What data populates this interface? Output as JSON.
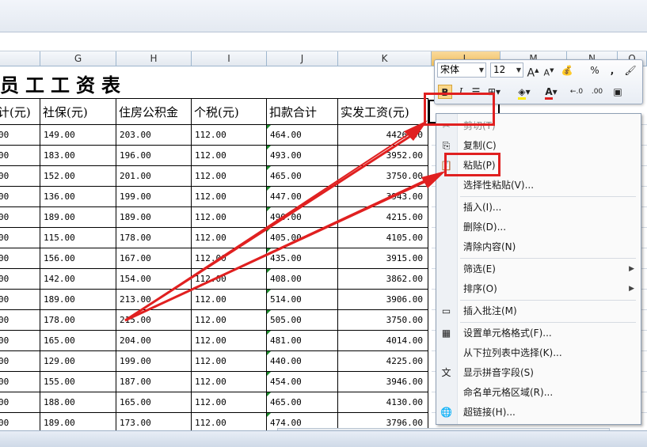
{
  "columns": [
    "G",
    "H",
    "I",
    "J",
    "K",
    "L",
    "M",
    "N",
    "O"
  ],
  "title": "员工工资表",
  "headers": [
    "计(元)",
    "社保(元)",
    "住房公积金",
    "个税(元)",
    "扣款合计",
    "实发工资(元)"
  ],
  "rows": [
    [
      "00",
      "149.00",
      "203.00",
      "112.00",
      "464.00",
      "4426.00"
    ],
    [
      "00",
      "183.00",
      "196.00",
      "112.00",
      "493.00",
      "3952.00"
    ],
    [
      "00",
      "152.00",
      "201.00",
      "112.00",
      "465.00",
      "3750.00"
    ],
    [
      "00",
      "136.00",
      "199.00",
      "112.00",
      "447.00",
      "3943.00"
    ],
    [
      "00",
      "189.00",
      "189.00",
      "112.00",
      "490.00",
      "4215.00"
    ],
    [
      "00",
      "115.00",
      "178.00",
      "112.00",
      "405.00",
      "4105.00"
    ],
    [
      "00",
      "156.00",
      "167.00",
      "112.00",
      "435.00",
      "3915.00"
    ],
    [
      "00",
      "142.00",
      "154.00",
      "112.00",
      "408.00",
      "3862.00"
    ],
    [
      "00",
      "189.00",
      "213.00",
      "112.00",
      "514.00",
      "3906.00"
    ],
    [
      "00",
      "178.00",
      "215.00",
      "112.00",
      "505.00",
      "3750.00"
    ],
    [
      "00",
      "165.00",
      "204.00",
      "112.00",
      "481.00",
      "4014.00"
    ],
    [
      "00",
      "129.00",
      "199.00",
      "112.00",
      "440.00",
      "4225.00"
    ],
    [
      "00",
      "155.00",
      "187.00",
      "112.00",
      "454.00",
      "3946.00"
    ],
    [
      "00",
      "188.00",
      "165.00",
      "112.00",
      "465.00",
      "4130.00"
    ],
    [
      "00",
      "189.00",
      "173.00",
      "112.00",
      "474.00",
      "3796.00"
    ]
  ],
  "mini_toolbar": {
    "font": "宋体",
    "size": "12",
    "grow": "A",
    "shrink": "A",
    "currency": "%",
    "comma": ",",
    "bold": "B",
    "italic": "I"
  },
  "context_menu": [
    {
      "label": "剪切(T)",
      "icon": "scissors-icon",
      "glyph": "✂",
      "disabled": true
    },
    {
      "label": "复制(C)",
      "icon": "copy-icon",
      "glyph": "⎘"
    },
    {
      "label": "粘贴(P)",
      "icon": "paste-icon",
      "glyph": "📋"
    },
    {
      "label": "选择性粘贴(V)..."
    },
    {
      "sep": true
    },
    {
      "label": "插入(I)..."
    },
    {
      "label": "删除(D)..."
    },
    {
      "label": "清除内容(N)"
    },
    {
      "sep": true
    },
    {
      "label": "筛选(E)",
      "submenu": true
    },
    {
      "label": "排序(O)",
      "submenu": true
    },
    {
      "sep": true
    },
    {
      "label": "插入批注(M)",
      "icon": "comment-icon",
      "glyph": "▭"
    },
    {
      "sep": true
    },
    {
      "label": "设置单元格格式(F)...",
      "icon": "format-cells-icon",
      "glyph": "▦"
    },
    {
      "label": "从下拉列表中选择(K)..."
    },
    {
      "label": "显示拼音字段(S)",
      "icon": "pinyin-icon",
      "glyph": "文"
    },
    {
      "label": "命名单元格区域(R)..."
    },
    {
      "label": "超链接(H)...",
      "icon": "hyperlink-icon",
      "glyph": "🌐"
    }
  ],
  "colors": {
    "highlight": "#e02020",
    "arrow": "#e02020",
    "marker": "#1b8a2b"
  }
}
